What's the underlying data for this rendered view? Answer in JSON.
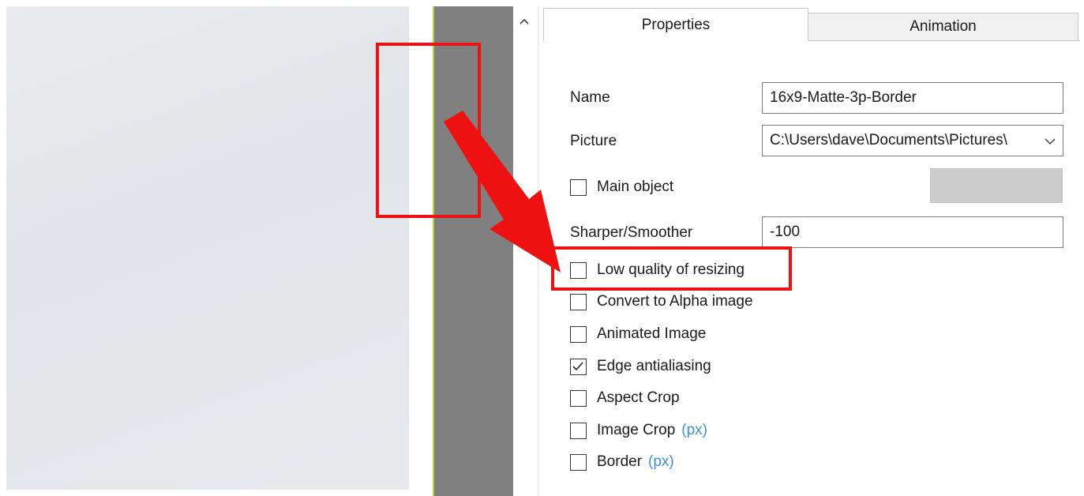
{
  "collapse": {
    "icon": "chevron-up-icon"
  },
  "tabs": {
    "properties": "Properties",
    "animation": "Animation"
  },
  "fields": {
    "name_label": "Name",
    "name_value": "16x9-Matte-3p-Border",
    "picture_label": "Picture",
    "picture_value": "C:\\Users\\dave\\Documents\\Pictures\\",
    "main_object_label": "Main object",
    "sharper_label": "Sharper/Smoother",
    "sharper_value": "-100"
  },
  "checkboxes": [
    {
      "label": "Main object",
      "checked": false
    },
    {
      "label": "Low quality of resizing",
      "checked": false
    },
    {
      "label": "Convert to Alpha image",
      "checked": false
    },
    {
      "label": "Animated Image",
      "checked": false
    },
    {
      "label": "Edge antialiasing",
      "checked": true
    },
    {
      "label": "Aspect Crop",
      "checked": false
    },
    {
      "label": "Image Crop",
      "unit": "(px)",
      "checked": false
    },
    {
      "label": "Border",
      "unit": "(px)",
      "checked": false
    }
  ],
  "colors": {
    "annotation_red": "#ee1111",
    "unit_blue": "#3d8fe0",
    "guide_green": "#b5d33a"
  }
}
